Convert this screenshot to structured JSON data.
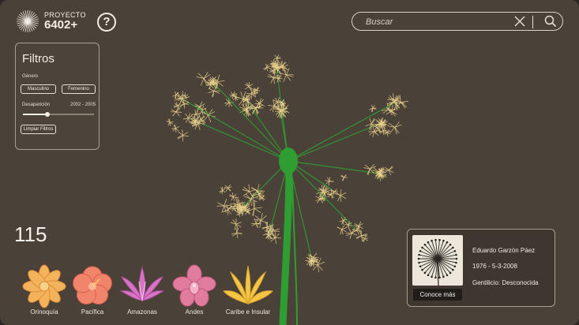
{
  "brand": {
    "top": "PROYECTO",
    "bottom": "6402+",
    "logo_icon": "dandelion-logo-icon"
  },
  "help": {
    "label": "?"
  },
  "search": {
    "placeholder": "Buscar",
    "clear_icon": "close-icon",
    "submit_icon": "search-icon"
  },
  "filters": {
    "title": "Filtros",
    "genero_label": "Género",
    "genero_options": [
      "Masculino",
      "Femenino"
    ],
    "desaparicion_label": "Desaparición",
    "desaparicion_range": "2002 - 2005",
    "slider_value": 0.34,
    "clear_button": "Limpiar Filtros"
  },
  "count": "115",
  "regions": [
    {
      "label": "Orinoquía",
      "color": "#f2b35a",
      "icon": "eight-petal-flower-icon"
    },
    {
      "label": "Pacífica",
      "color": "#f0856b",
      "icon": "hibiscus-icon"
    },
    {
      "label": "Amazonas",
      "color": "#d874c4",
      "icon": "lily-icon"
    },
    {
      "label": "Andes",
      "color": "#e27c9e",
      "icon": "orchid-icon"
    },
    {
      "label": "Caribe e Insular",
      "color": "#f5c646",
      "icon": "heliconia-icon"
    }
  ],
  "profile": {
    "name": "Eduardo Garzón Páez",
    "dates": "1976 - 5-3-2008",
    "gentilicio": "Gentilicio: Desconocida",
    "button": "Conoce más",
    "thumb_icon": "dandelion-portrait-icon"
  },
  "colors": {
    "background": "#4a4139",
    "stem": "#2f9e32",
    "seeds": "#e9d08a",
    "accent_text": "#f3eee6"
  }
}
